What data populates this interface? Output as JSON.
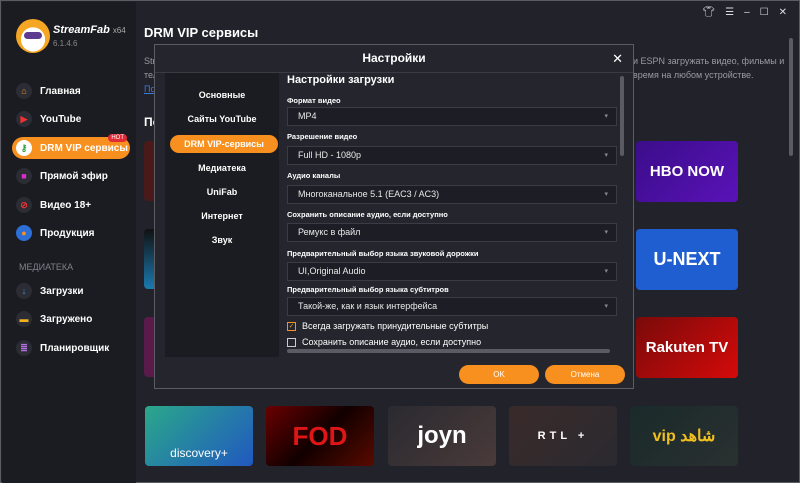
{
  "app": {
    "name": "StreamFab",
    "arch": "x64",
    "version": "6.1.4.6"
  },
  "window_controls": [
    "shirt-icon",
    "menu-icon",
    "minimize-icon",
    "maximize-icon",
    "close-icon"
  ],
  "sidebar": {
    "items": [
      {
        "label": "Главная",
        "icon": "home-icon"
      },
      {
        "label": "YouTube",
        "icon": "youtube-icon"
      },
      {
        "label": "DRM VIP сервисы",
        "icon": "key-icon",
        "badge": "HOT"
      },
      {
        "label": "Прямой эфир",
        "icon": "camera-icon"
      },
      {
        "label": "Видео 18+",
        "icon": "adult-icon"
      },
      {
        "label": "Продукция",
        "icon": "product-icon"
      }
    ],
    "section": "МЕДИАТЕКА",
    "library": [
      {
        "label": "Загрузки",
        "icon": "download-icon"
      },
      {
        "label": "Загружено",
        "icon": "folder-icon"
      },
      {
        "label": "Планировщик",
        "icon": "scheduler-icon"
      }
    ]
  },
  "main": {
    "title": "DRM VIP сервисы",
    "desc_l1_left": "Str",
    "desc_l1_right": "и ESPN загружать видео, фильмы и",
    "desc_l2_left": "тел",
    "desc_l2_right": "время на любом устройстве.",
    "link": "По",
    "section": "По",
    "tiles": [
      "HBO NOW",
      "U-NEXT",
      "Rakuten TV",
      "discovery+",
      "FOD",
      "joyn",
      "RTL +",
      "vip شاهد"
    ]
  },
  "modal": {
    "title": "Настройки",
    "nav": [
      "Основные",
      "Сайты YouTube",
      "DRM VIP-сервисы",
      "Медиатека",
      "UniFab",
      "Интернет",
      "Звук"
    ],
    "section_title": "Настройки загрузки",
    "fields": [
      {
        "label": "Формат видео",
        "value": "MP4"
      },
      {
        "label": "Разрешение видео",
        "value": "Full HD - 1080p"
      },
      {
        "label": "Аудио каналы",
        "value": "Многоканальное 5.1 (EAC3 / AC3)"
      },
      {
        "label": "Сохранить описание аудио, если доступно",
        "value": "Ремукс в файл"
      },
      {
        "label": "Предварительный выбор языка звуковой дорожки",
        "value": "UI,Original Audio"
      },
      {
        "label": "Предварительный выбор языка субтитров",
        "value": "Такой-же, как и язык интерфейса"
      }
    ],
    "checkboxes": [
      {
        "label": "Всегда загружать принудительные субтитры",
        "checked": true
      },
      {
        "label": "Сохранить описание аудио, если доступно",
        "checked": false
      }
    ],
    "ok": "OK",
    "cancel": "Отмена"
  },
  "colors": {
    "accent": "#f7901e",
    "bg": "#21222a",
    "sidebar": "#1b1c22"
  }
}
